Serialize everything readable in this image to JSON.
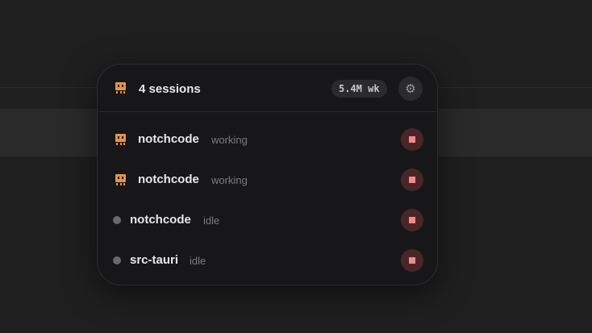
{
  "header": {
    "title": "4 sessions",
    "usage_badge": "5.4M wk",
    "settings_icon": "gear-icon"
  },
  "sessions": [
    {
      "name": "notchcode",
      "status": "working",
      "indicator": "sprite-icon"
    },
    {
      "name": "notchcode",
      "status": "working",
      "indicator": "sprite-icon"
    },
    {
      "name": "notchcode",
      "status": "idle",
      "indicator": "idle-dot"
    },
    {
      "name": "src-tauri",
      "status": "idle",
      "indicator": "idle-dot"
    }
  ],
  "colors": {
    "accent": "#e5924a",
    "stop_bg": "#4a2528",
    "stop_fg": "#f08a8c",
    "panel_bg": "#171719"
  }
}
